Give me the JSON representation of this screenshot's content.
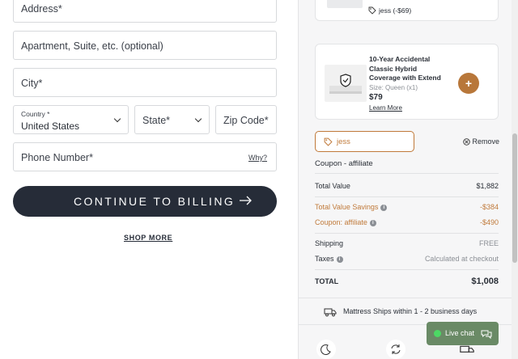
{
  "form": {
    "address_placeholder": "Address*",
    "apartment_placeholder": "Apartment, Suite, etc. (optional)",
    "city_placeholder": "City*",
    "country_label": "Country *",
    "country_value": "United States",
    "state_placeholder": "State*",
    "zip_placeholder": "Zip Code*",
    "phone_placeholder": "Phone Number*",
    "why_link": "Why?",
    "continue_button": "CONTINUE TO BILLING",
    "shop_more_link": "SHOP MORE"
  },
  "summary": {
    "top_item_coupon_text": "jess (-$69)",
    "addon": {
      "title": "10-Year Accidental Classic Hybrid Coverage with Extend",
      "size": "Size: Queen (x1)",
      "price": "$79",
      "learn_more": "Learn More",
      "add_label": "+"
    },
    "coupon_code": "jess",
    "remove_label": "Remove",
    "coupon_type": "Coupon - affiliate",
    "total_value_label": "Total Value",
    "total_value": "$1,882",
    "savings_label": "Total Value Savings",
    "savings_value": "-$384",
    "coupon_affiliate_label": "Coupon: affiliate",
    "coupon_affiliate_value": "-$490",
    "shipping_label": "Shipping",
    "shipping_value": "FREE",
    "taxes_label": "Taxes",
    "taxes_value": "Calculated at checkout",
    "total_label": "TOTAL",
    "total_value_final": "$1,008",
    "ships_text": "Mattress Ships within 1 - 2 business days",
    "live_chat": "Live chat"
  },
  "colors": {
    "primary_dark": "#262c38",
    "accent_orange": "#c07a3a",
    "chat_green": "#6a8a66"
  }
}
